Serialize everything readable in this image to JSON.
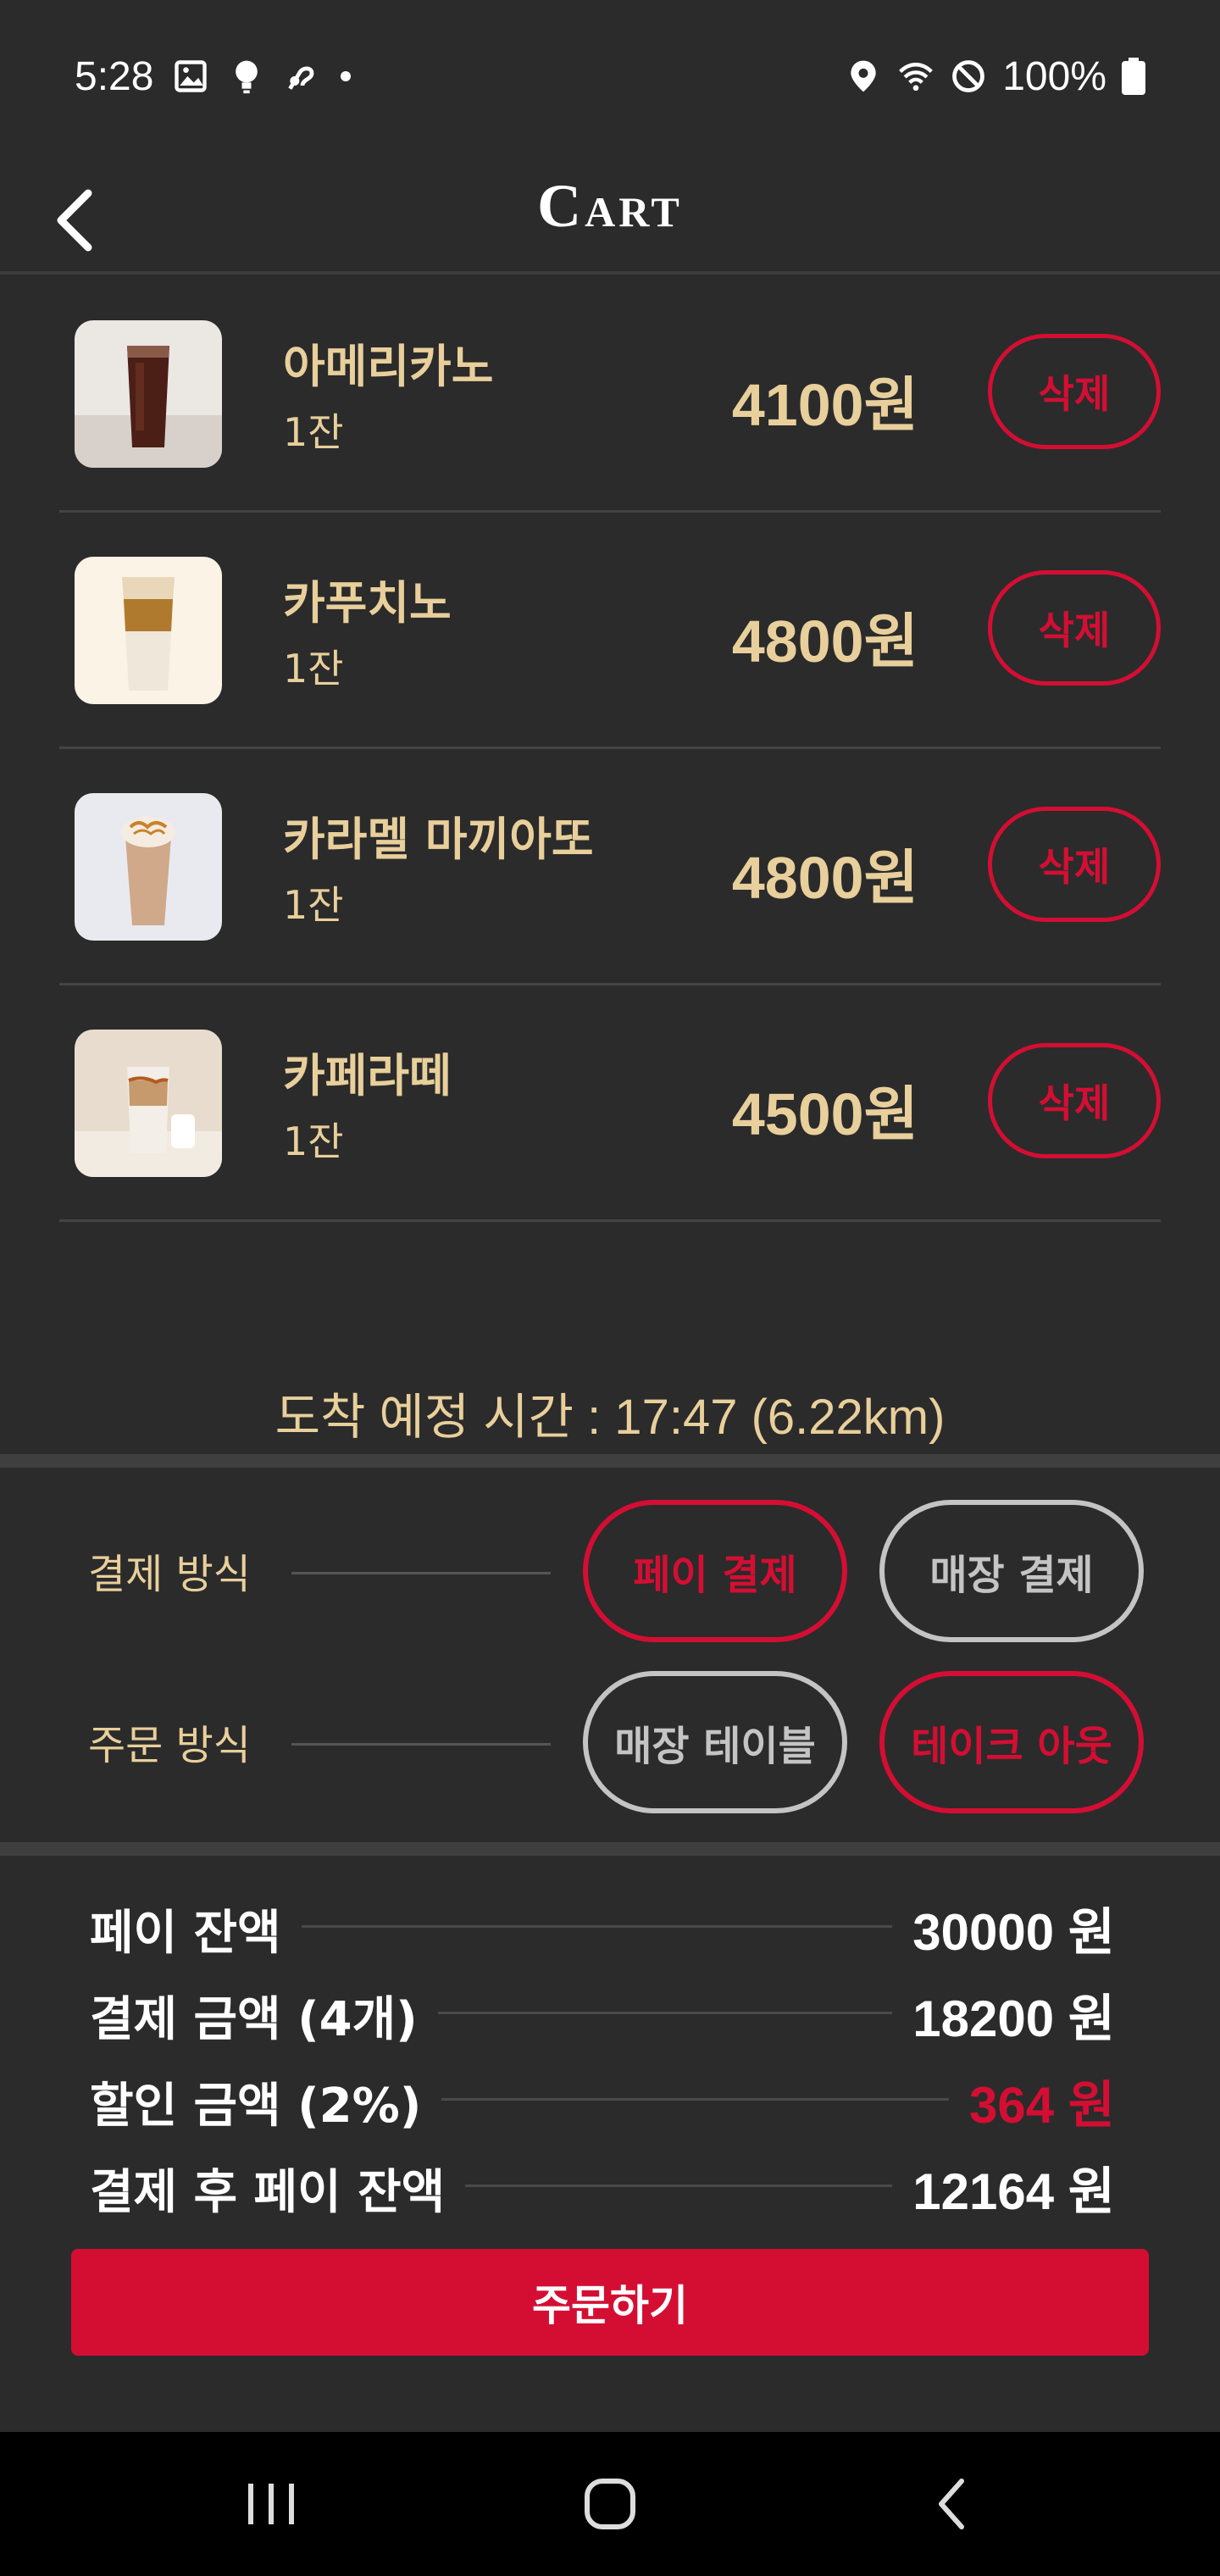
{
  "status_bar": {
    "time": "5:28",
    "battery": "100%"
  },
  "header": {
    "title": "Cart"
  },
  "cart": {
    "items": [
      {
        "name": "아메리카노",
        "qty": "1잔",
        "price": "4100원",
        "delete_label": "삭제"
      },
      {
        "name": "카푸치노",
        "qty": "1잔",
        "price": "4800원",
        "delete_label": "삭제"
      },
      {
        "name": "카라멜 마끼아또",
        "qty": "1잔",
        "price": "4800원",
        "delete_label": "삭제"
      },
      {
        "name": "카페라떼",
        "qty": "1잔",
        "price": "4500원",
        "delete_label": "삭제"
      }
    ]
  },
  "arrival": {
    "text": "도착 예정 시간 : 17:47 (6.22km)"
  },
  "options": {
    "payment": {
      "label": "결제 방식",
      "choices": [
        "페이 결제",
        "매장 결제"
      ],
      "selected": "페이 결제"
    },
    "order": {
      "label": "주문 방식",
      "choices": [
        "매장 테이블",
        "테이크 아웃"
      ],
      "selected": "테이크 아웃"
    }
  },
  "summary": {
    "rows": [
      {
        "label": "페이 잔액",
        "value": "30000 원"
      },
      {
        "label": "결제 금액 (4개)",
        "value": "18200 원"
      },
      {
        "label": "할인 금액 (2%)",
        "value": "364 원"
      },
      {
        "label": "결제 후 페이 잔액",
        "value": "12164 원"
      }
    ]
  },
  "order_button": {
    "label": "주문하기"
  },
  "colors": {
    "background": "#2b2b2b",
    "accent_red": "#d40e33",
    "gold": "#e8cf9b",
    "inactive": "#c4c4c4"
  }
}
